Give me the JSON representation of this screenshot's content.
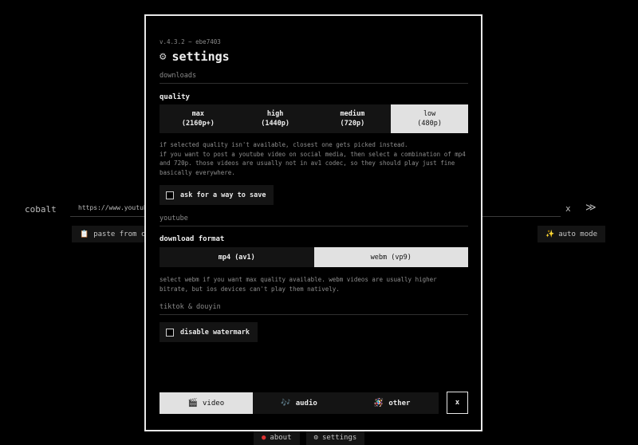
{
  "background": {
    "brand": "cobalt",
    "url_value": "https://www.youtube",
    "clear_label": "x",
    "go_label": "≫",
    "paste_label": "paste from cli",
    "auto_label": "auto mode",
    "footer": {
      "about_label": "about",
      "settings_label": "settings"
    }
  },
  "settings": {
    "version": "v.4.3.2 ~ ebe7403",
    "title": "settings",
    "downloads": {
      "section_label": "downloads",
      "quality_label": "quality",
      "quality_options": [
        {
          "label": "max",
          "sub": "(2160p+)"
        },
        {
          "label": "high",
          "sub": "(1440p)"
        },
        {
          "label": "medium",
          "sub": "(720p)"
        },
        {
          "label": "low",
          "sub": "(480p)"
        }
      ],
      "selected_quality": "low",
      "description": "if selected quality isn't available, closest one gets picked instead.\nif you want to post a youtube video on social media, then select a combination of mp4 and 720p. those videos are usually not in av1 codec, so they should play just fine basically everywhere.",
      "ask_save_label": "ask for a way to save"
    },
    "youtube": {
      "section_label": "youtube",
      "format_label": "download format",
      "format_options": [
        "mp4 (av1)",
        "webm (vp9)"
      ],
      "selected_format": "webm (vp9)",
      "description": "select webm if you want max quality available. webm videos are usually higher bitrate, but ios devices can't play them natively."
    },
    "tiktok": {
      "section_label": "tiktok & douyin",
      "watermark_label": "disable watermark"
    },
    "tabs": [
      {
        "label": "video",
        "icon": "clapper-icon"
      },
      {
        "label": "audio",
        "icon": "music-icon"
      },
      {
        "label": "other",
        "icon": "tool-icon"
      }
    ],
    "active_tab": "video",
    "close_label": "x"
  }
}
